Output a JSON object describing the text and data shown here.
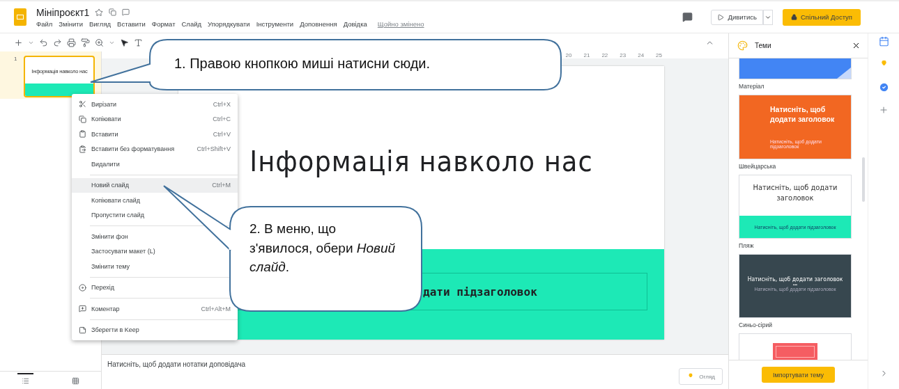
{
  "app": {
    "title": "Мініпроєкт1",
    "menu": [
      "Файл",
      "Змінити",
      "Вигляд",
      "Вставити",
      "Формат",
      "Слайд",
      "Упорядкувати",
      "Інструменти",
      "Доповнення",
      "Довідка"
    ],
    "status": "Щойно змінено"
  },
  "header_buttons": {
    "present": "Дивитись",
    "share": "Спільний Доступ"
  },
  "ruler": [
    "20",
    "21",
    "22",
    "23",
    "24",
    "25"
  ],
  "filmstrip": [
    {
      "number": "1",
      "title": "Інформація навколо нас",
      "selected": true
    }
  ],
  "slide": {
    "title": "Інформація навколо нас",
    "subtitle": "дати підзаголовок"
  },
  "notes": {
    "placeholder": "Натисніть, щоб додати нотатки доповідача"
  },
  "overview_button": "Огляд",
  "context_menu": [
    {
      "kind": "item",
      "label": "Вирізати",
      "shortcut": "Ctrl+X",
      "selected": false
    },
    {
      "kind": "item",
      "label": "Копіювати",
      "shortcut": "Ctrl+C",
      "selected": false
    },
    {
      "kind": "item",
      "label": "Вставити",
      "shortcut": "Ctrl+V",
      "selected": false
    },
    {
      "kind": "item",
      "label": "Вставити без форматування",
      "shortcut": "Ctrl+Shift+V",
      "selected": false
    },
    {
      "kind": "item",
      "label": "Видалити",
      "selected": false
    },
    {
      "kind": "divider"
    },
    {
      "kind": "item",
      "label": "Новий слайд",
      "shortcut": "Ctrl+M",
      "selected": true
    },
    {
      "kind": "item",
      "label": "Копіювати слайд",
      "selected": false
    },
    {
      "kind": "item",
      "label": "Пропустити слайд",
      "selected": false
    },
    {
      "kind": "divider"
    },
    {
      "kind": "item",
      "label": "Змінити фон",
      "selected": false
    },
    {
      "kind": "item",
      "label": "Застосувати макет (L)",
      "selected": false
    },
    {
      "kind": "item",
      "label": "Змінити тему",
      "selected": false
    },
    {
      "kind": "divider"
    },
    {
      "kind": "item",
      "label": "Перехід",
      "selected": false
    },
    {
      "kind": "divider"
    },
    {
      "kind": "item",
      "label": "Коментар",
      "shortcut": "Ctrl+Alt+M",
      "selected": false
    },
    {
      "kind": "divider"
    },
    {
      "kind": "item",
      "label": "Зберегти в Keep",
      "selected": false
    }
  ],
  "themes_panel": {
    "title": "Теми",
    "themes": [
      {
        "kind": "material",
        "name": "Матеріал"
      },
      {
        "kind": "swiss",
        "name": "Швейцарська",
        "title": "Натисніть, щоб додати заголовок",
        "subtitle": "Натисніть, щоб додати підзаголовок"
      },
      {
        "kind": "beach",
        "name": "Пляж",
        "title": "Натисніть, щоб додати заголовок",
        "subtitle": "Натисніть, щоб додати підзаголовок"
      },
      {
        "kind": "slate",
        "name": "Синьо-сірий",
        "title": "Натисніть, щоб додати заголовок",
        "dots": "•••",
        "subtitle": "Натисніть, щоб додати підзаголовок"
      },
      {
        "kind": "coral"
      }
    ],
    "import_button": "Імпортувати тему"
  },
  "callouts": [
    {
      "text": "1. Правою кнопкою миші натисни сюди."
    },
    {
      "text": "2. В меню, що з'явилося, обери *Новий слайд*."
    }
  ]
}
